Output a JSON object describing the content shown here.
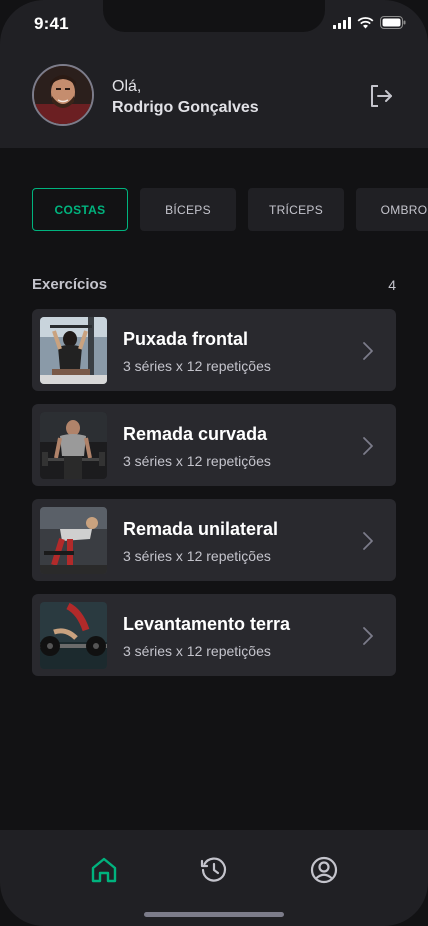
{
  "status_bar": {
    "time": "9:41"
  },
  "header": {
    "greeting": "Olá,",
    "user_name": "Rodrigo Gonçalves"
  },
  "tabs": [
    {
      "label": "COSTAS",
      "active": true
    },
    {
      "label": "BÍCEPS",
      "active": false
    },
    {
      "label": "TRÍCEPS",
      "active": false
    },
    {
      "label": "OMBRO",
      "active": false
    }
  ],
  "exercises_section": {
    "title": "Exercícios",
    "count": "4",
    "items": [
      {
        "name": "Puxada frontal",
        "details": "3 séries x 12 repetições"
      },
      {
        "name": "Remada curvada",
        "details": "3 séries x 12 repetições"
      },
      {
        "name": "Remada unilateral",
        "details": "3 séries x 12 repetições"
      },
      {
        "name": "Levantamento terra",
        "details": "3 séries x 12 repetições"
      }
    ]
  },
  "bottom_nav": {
    "items": [
      {
        "icon": "home-icon",
        "active": true
      },
      {
        "icon": "history-icon",
        "active": false
      },
      {
        "icon": "profile-icon",
        "active": false
      }
    ]
  },
  "colors": {
    "accent": "#00b37e",
    "background": "#121214",
    "surface": "#202024",
    "card": "#29292e"
  }
}
